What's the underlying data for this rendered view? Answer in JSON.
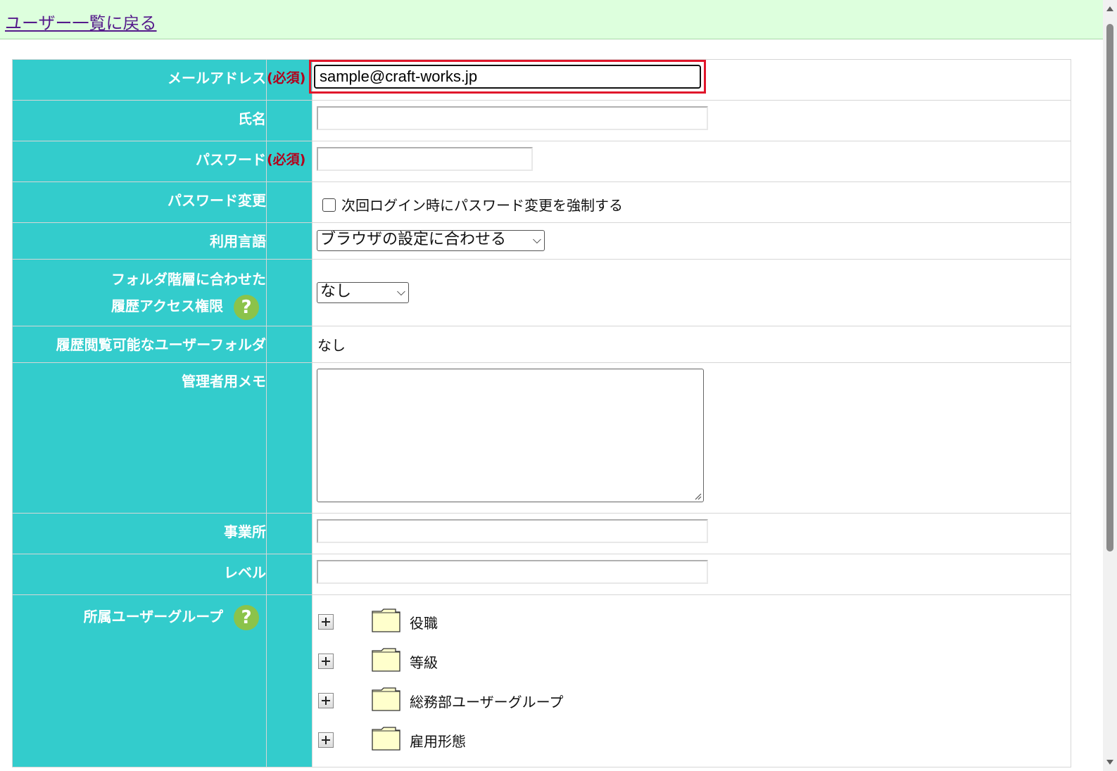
{
  "header": {
    "back_link": "ユーザー一覧に戻る"
  },
  "required_mark": "(必須)",
  "fields": {
    "email": {
      "label": "メールアドレス",
      "value": "sample@craft-works.jp"
    },
    "name": {
      "label": "氏名",
      "value": ""
    },
    "password": {
      "label": "パスワード",
      "value": ""
    },
    "password_change": {
      "label": "パスワード変更",
      "checkbox_label": "次回ログイン時にパスワード変更を強制する",
      "checked": false
    },
    "language": {
      "label": "利用言語",
      "selected": "ブラウザの設定に合わせる"
    },
    "history_access": {
      "label_line1": "フォルダ階層に合わせた",
      "label_line2": "履歴アクセス権限",
      "selected": "なし"
    },
    "viewable_folder": {
      "label": "履歴閲覧可能なユーザーフォルダ",
      "value": "なし"
    },
    "admin_memo": {
      "label": "管理者用メモ",
      "value": ""
    },
    "office": {
      "label": "事業所",
      "value": ""
    },
    "level": {
      "label": "レベル",
      "value": ""
    },
    "user_groups": {
      "label": "所属ユーザーグループ",
      "items": [
        "役職",
        "等級",
        "総務部ユーザーグループ",
        "雇用形態"
      ]
    }
  },
  "help_icon_glyph": "?",
  "colors": {
    "label_bg": "#33cccc",
    "required": "#b3001b",
    "topbar_bg": "#ddffdd",
    "highlight": "#e0162b",
    "help_icon": "#8bc34a"
  }
}
